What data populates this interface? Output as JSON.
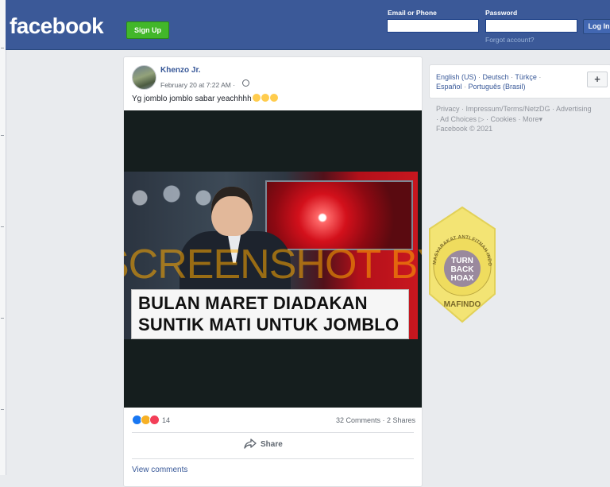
{
  "header": {
    "logo": "facebook",
    "signup_label": "Sign Up",
    "email_label": "Email or Phone",
    "password_label": "Password",
    "login_label": "Log In",
    "forgot_label": "Forgot account?"
  },
  "post": {
    "author": "Khenzo Jr.",
    "date": "February 20 at 7:22 AM ·",
    "text": "Yg jomblo jomblo sabar yeachhhh",
    "media": {
      "watermark": "SCREENSHOT BY",
      "caption_line1": "BULAN MARET DIADAKAN",
      "caption_line2": "SUNTIK MATI UNTUK JOMBLO"
    },
    "reaction_count": "14",
    "comments_shares": "32 Comments · 2 Shares",
    "share_label": "Share",
    "view_comments": "View comments"
  },
  "sidebar": {
    "languages_row1": [
      "English (US)",
      "Deutsch",
      "Türkçe"
    ],
    "languages_row2": [
      "Español",
      "Português (Brasil)"
    ],
    "plus_label": "+",
    "footer_row1": [
      "Privacy",
      "Impressum/Terms/NetzDG",
      "Advertising"
    ],
    "footer_row2": [
      "Ad Choices",
      "Cookies",
      "More"
    ],
    "copyright": "Facebook © 2021"
  },
  "badge": {
    "arc_text": "MASYARAKAT ANTI FITNAH INDONESIA",
    "center_line1": "TURN",
    "center_line2": "BACK",
    "center_line3": "HOAX",
    "name": "MAFINDO"
  },
  "colors": {
    "brand_blue": "#3b5998",
    "signup_green": "#42b72a",
    "link_blue": "#385898",
    "badge_yellow": "#f4e46a"
  }
}
